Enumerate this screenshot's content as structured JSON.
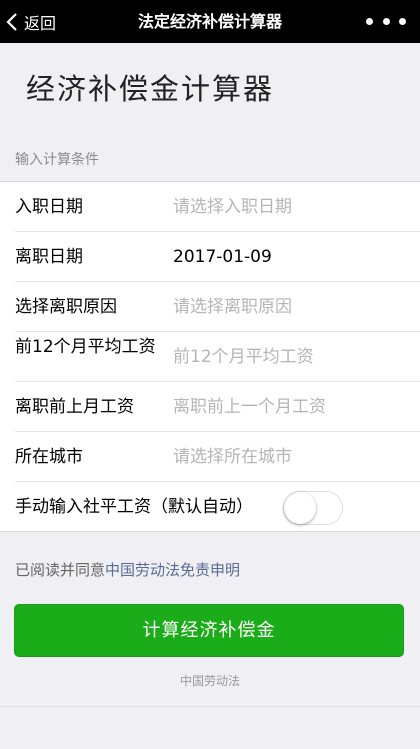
{
  "nav": {
    "back_label": "返回",
    "title": "法定经济补偿计算器",
    "more_icon": "more-dots-icon",
    "back_icon": "chevron-left-icon"
  },
  "page_title": "经济补偿金计算器",
  "section_label": "输入计算条件",
  "rows": [
    {
      "label": "入职日期",
      "value": "请选择入职日期",
      "state": "placeholder"
    },
    {
      "label": "离职日期",
      "value": "2017-01-09",
      "state": "filled"
    },
    {
      "label": "选择离职原因",
      "value": "请选择离职原因",
      "state": "placeholder"
    },
    {
      "label": "前12个月平均工资",
      "value": "前12个月平均工资",
      "state": "placeholder"
    },
    {
      "label": "离职前上月工资",
      "value": "离职前上一个月工资",
      "state": "placeholder"
    },
    {
      "label": "所在城市",
      "value": "请选择所在城市",
      "state": "placeholder"
    },
    {
      "label": "手动输入社平工资（默认自动）",
      "switch_on": false
    }
  ],
  "agreement": {
    "prefix": "已阅读并同意",
    "link": "中国劳动法免责申明"
  },
  "submit_label": "计算经济补偿金",
  "footer": "中国劳动法",
  "colors": {
    "primary": "#1aad19",
    "link": "#586c94",
    "placeholder": "#b5b5b5",
    "background": "#efeff4",
    "navbar": "#000000"
  }
}
